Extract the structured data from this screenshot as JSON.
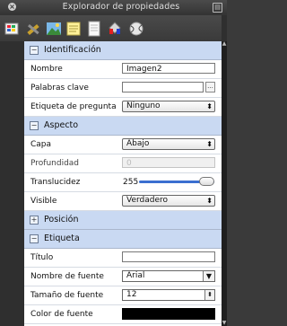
{
  "window": {
    "title": "Explorador de propiedades",
    "close_glyph": "×",
    "menu_glyph": "▤"
  },
  "toolbar": {
    "icons": [
      "palette-icon",
      "tools-icon",
      "landscape-icon",
      "notes-icon",
      "document-icon",
      "paint-bucket-icon",
      "tennis-ball-icon"
    ]
  },
  "sections": {
    "identificacion": {
      "title": "Identificación",
      "toggle": "−"
    },
    "aspecto": {
      "title": "Aspecto",
      "toggle": "−"
    },
    "posicion": {
      "title": "Posición",
      "toggle": "+"
    },
    "etiqueta": {
      "title": "Etiqueta",
      "toggle": "−"
    }
  },
  "fields": {
    "nombre": {
      "label": "Nombre",
      "value": "Imagen2"
    },
    "palabras_clave": {
      "label": "Palabras clave",
      "value": "",
      "button": "..."
    },
    "etiqueta_pregunta": {
      "label": "Etiqueta de pregunta",
      "value": "Ninguno"
    },
    "capa": {
      "label": "Capa",
      "value": "Abajo"
    },
    "profundidad": {
      "label": "Profundidad",
      "value": "0"
    },
    "translucidez": {
      "label": "Translucidez",
      "value": "255",
      "fill": 1.0
    },
    "visible": {
      "label": "Visible",
      "value": "Verdadero"
    },
    "titulo": {
      "label": "Título",
      "value": ""
    },
    "nombre_fuente": {
      "label": "Nombre de fuente",
      "value": "Arial"
    },
    "tamano_fuente": {
      "label": "Tamaño de fuente",
      "value": "12"
    },
    "color_fuente": {
      "label": "Color de fuente",
      "color": "#000000"
    }
  },
  "glyphs": {
    "updown": "⬍",
    "down": "▼",
    "scroll_up": "▲",
    "scroll_down": "▼"
  }
}
